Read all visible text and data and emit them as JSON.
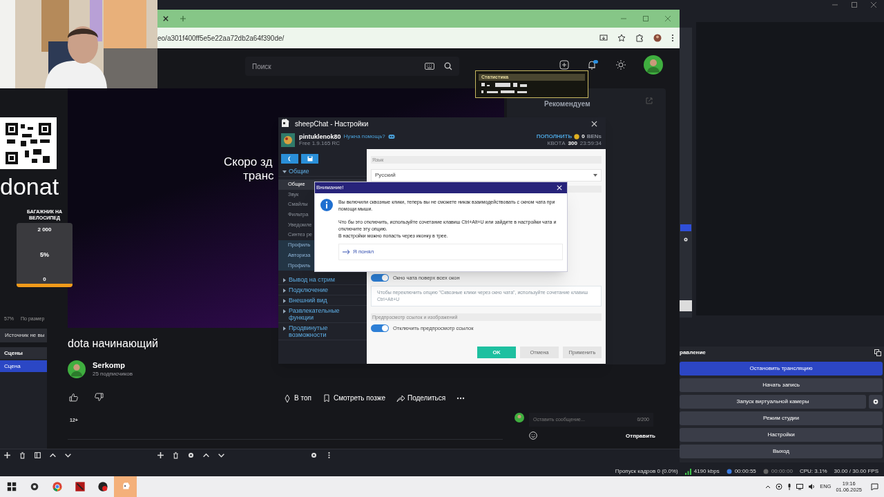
{
  "obs": {
    "controls": {
      "title": "равление",
      "buttons": [
        {
          "label": "Остановить трансляцию",
          "selected": true,
          "kind": "plain"
        },
        {
          "label": "Начать запись",
          "selected": false,
          "kind": "plain"
        },
        {
          "label": "Запуск виртуальной камеры",
          "selected": false,
          "kind": "with_settings"
        },
        {
          "label": "Режим студии",
          "selected": false,
          "kind": "plain"
        },
        {
          "label": "Настройки",
          "selected": false,
          "kind": "plain"
        },
        {
          "label": "Выход",
          "selected": false,
          "kind": "plain"
        }
      ]
    },
    "scenes": {
      "title": "Сцены",
      "items": [
        {
          "label": "Сцена",
          "selected": true
        }
      ]
    },
    "preview_info": {
      "zoom": "57%",
      "fit": "По размер",
      "source": "Источник не вы"
    },
    "status_bar": {
      "dropped_frames": "Пропуск кадров 0 (0.0%)",
      "bitrate": "4190 kbps",
      "stream_time": "00:00:55",
      "record_time": "00:00:00",
      "cpu": "CPU: 3.1%",
      "fps": "30.00 / 30.00 FPS"
    }
  },
  "overlays": {
    "donate_label": "donat",
    "goal": {
      "title": "БАГАЖНИК НА ВЕЛОСИПЕД",
      "max": "2 000",
      "percent": "5%",
      "min": "0",
      "level": 0.05
    },
    "stats": {
      "title": "Статистика"
    }
  },
  "browser": {
    "url": "eo/a301f400ff5e5e22aa72db2a64f390de/",
    "page": {
      "search_placeholder": "Поиск",
      "recommend": "Рекомендуем",
      "video_text": [
        "Скоро зд",
        "транс"
      ],
      "title": "dota начинающий",
      "channel": "Serkomp",
      "subscribers": "25 подписчиков",
      "actions": [
        "В топ",
        "Смотреть позже",
        "Поделиться"
      ],
      "age": "12+",
      "comment_placeholder": "Оставить сообщение...",
      "counter": "0/200",
      "send": "Отправить"
    }
  },
  "sheepchat": {
    "title": "sheepChat - Настройки",
    "user": "pintuklenok80",
    "help": "Нужна помощь?",
    "version": "Free 1.9.165 RC",
    "topup": "ПОПОЛНИТЬ",
    "balance": "0",
    "currency": "BENs",
    "quota_label": "КВОТА",
    "quota": "300",
    "timer": "23:59:34",
    "nav": [
      {
        "label": "Общие",
        "expanded": true,
        "children": [
          {
            "label": "Общие",
            "selected": true,
            "kind": "page"
          },
          {
            "label": "Звук",
            "selected": false,
            "kind": "page"
          },
          {
            "label": "Смайлы",
            "selected": false,
            "kind": "page"
          },
          {
            "label": "Фильтра",
            "selected": false,
            "kind": "page"
          },
          {
            "label": "Уведомле",
            "selected": false,
            "kind": "page"
          },
          {
            "label": "Синтез ре",
            "selected": false,
            "kind": "page"
          },
          {
            "label": "Профиль",
            "selected": false,
            "kind": "profile"
          },
          {
            "label": "Авториза",
            "selected": false,
            "kind": "profile"
          },
          {
            "label": "Профиль",
            "selected": false,
            "kind": "profile"
          }
        ]
      },
      {
        "label": "Вывод на стрим",
        "expanded": false
      },
      {
        "label": "Подключение",
        "expanded": false
      },
      {
        "label": "Внешний вид",
        "expanded": false
      },
      {
        "label": "Развлекательные функции",
        "expanded": false
      },
      {
        "label": "Продвинутые возможности",
        "expanded": false
      }
    ],
    "language_label": "Язык",
    "language": "Русский",
    "toggle": {
      "label": "Окно чата поверх всех окон",
      "on": true
    },
    "hint": "Чтобы переключить опцию \"Сквозные клики через окно чата\", используйте сочетание клавиш Ctrl+Alt+U",
    "section": "Предпросмотр ссылок и изображений",
    "toggle2": {
      "label": "Отключить предпросмотр ссылок",
      "on": true
    },
    "buttons": [
      {
        "label": "OK",
        "kind": "primary"
      },
      {
        "label": "Отмена",
        "kind": "secondary"
      },
      {
        "label": "Применить",
        "kind": "secondary"
      }
    ]
  },
  "dialog": {
    "title": "Внимание!",
    "paragraphs": [
      "Вы включили сквозные клики, теперь вы не сможете никак взаимодействовать с окном чата при помощи мыши.",
      "Что бы это отключить, используйте сочетание клавиш Ctrl+Alt+U или зайдите в настройки чата и отключите эту опцию.\nВ настройки можно попасть через иконку в трее."
    ],
    "action": "Я понял"
  },
  "taskbar": {
    "language": "ENG",
    "time": "19:16",
    "date": "01.06.2025"
  }
}
